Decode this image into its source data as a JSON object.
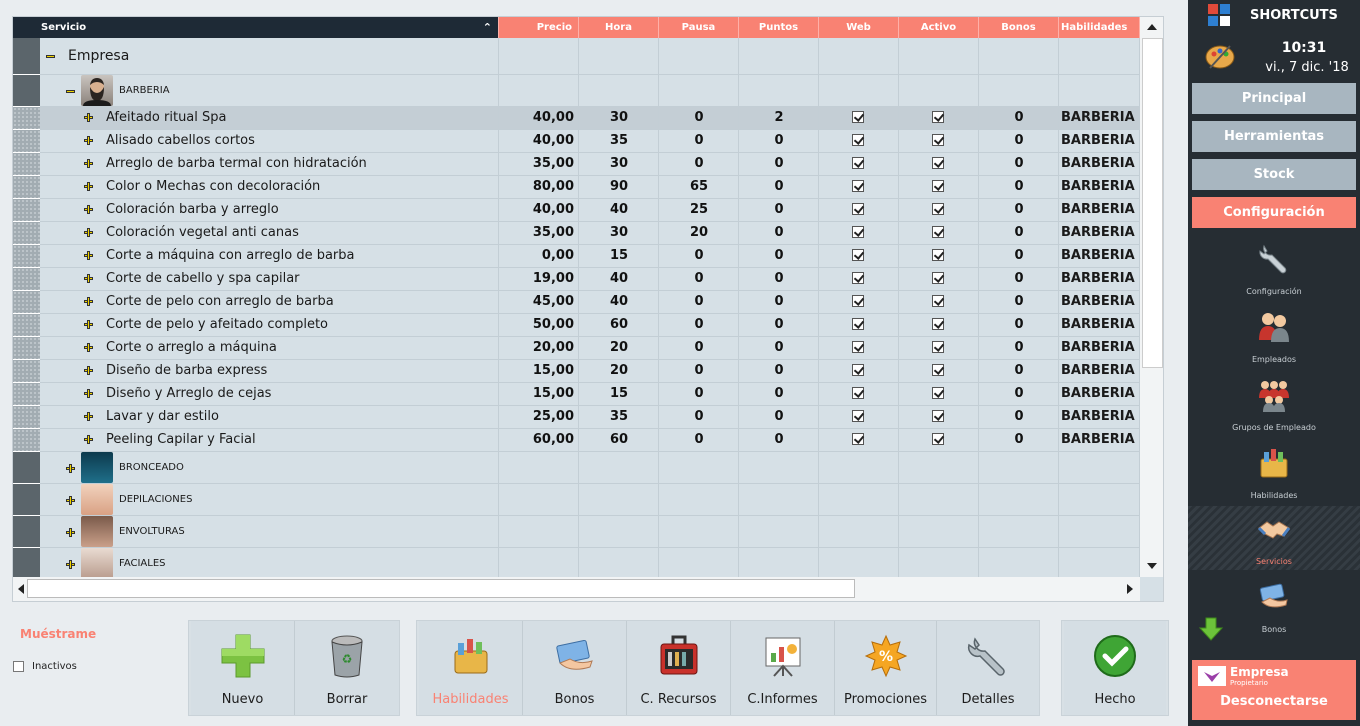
{
  "grid": {
    "columns": [
      "Servicio",
      "Precio",
      "Hora",
      "Pausa",
      "Puntos",
      "Web",
      "Activo",
      "Bonos",
      "Habilidades"
    ],
    "root_label": "Empresa",
    "group_expanded": "BARBERIA",
    "rows": [
      {
        "name": "Afeitado ritual Spa",
        "precio": "40,00",
        "hora": "30",
        "pausa": "0",
        "puntos": "2",
        "web": true,
        "activo": true,
        "bonos": "0",
        "hab": "BARBERIA"
      },
      {
        "name": "Alisado cabellos cortos",
        "precio": "40,00",
        "hora": "35",
        "pausa": "0",
        "puntos": "0",
        "web": true,
        "activo": true,
        "bonos": "0",
        "hab": "BARBERIA"
      },
      {
        "name": "Arreglo de barba termal con hidratación",
        "precio": "35,00",
        "hora": "30",
        "pausa": "0",
        "puntos": "0",
        "web": true,
        "activo": true,
        "bonos": "0",
        "hab": "BARBERIA"
      },
      {
        "name": "Color o Mechas con decoloración",
        "precio": "80,00",
        "hora": "90",
        "pausa": "65",
        "puntos": "0",
        "web": true,
        "activo": true,
        "bonos": "0",
        "hab": "BARBERIA"
      },
      {
        "name": "Coloración barba y arreglo",
        "precio": "40,00",
        "hora": "40",
        "pausa": "25",
        "puntos": "0",
        "web": true,
        "activo": true,
        "bonos": "0",
        "hab": "BARBERIA"
      },
      {
        "name": "Coloración vegetal anti canas",
        "precio": "35,00",
        "hora": "30",
        "pausa": "20",
        "puntos": "0",
        "web": true,
        "activo": true,
        "bonos": "0",
        "hab": "BARBERIA"
      },
      {
        "name": "Corte a máquina con arreglo de barba",
        "precio": "0,00",
        "hora": "15",
        "pausa": "0",
        "puntos": "0",
        "web": true,
        "activo": true,
        "bonos": "0",
        "hab": "BARBERIA"
      },
      {
        "name": "Corte de cabello y spa capilar",
        "precio": "19,00",
        "hora": "40",
        "pausa": "0",
        "puntos": "0",
        "web": true,
        "activo": true,
        "bonos": "0",
        "hab": "BARBERIA"
      },
      {
        "name": "Corte de pelo con arreglo de barba",
        "precio": "45,00",
        "hora": "40",
        "pausa": "0",
        "puntos": "0",
        "web": true,
        "activo": true,
        "bonos": "0",
        "hab": "BARBERIA"
      },
      {
        "name": "Corte de pelo y afeitado completo",
        "precio": "50,00",
        "hora": "60",
        "pausa": "0",
        "puntos": "0",
        "web": true,
        "activo": true,
        "bonos": "0",
        "hab": "BARBERIA"
      },
      {
        "name": "Corte o arreglo a máquina",
        "precio": "20,00",
        "hora": "20",
        "pausa": "0",
        "puntos": "0",
        "web": true,
        "activo": true,
        "bonos": "0",
        "hab": "BARBERIA"
      },
      {
        "name": "Diseño de barba express",
        "precio": "15,00",
        "hora": "20",
        "pausa": "0",
        "puntos": "0",
        "web": true,
        "activo": true,
        "bonos": "0",
        "hab": "BARBERIA"
      },
      {
        "name": "Diseño y Arreglo de cejas",
        "precio": "15,00",
        "hora": "15",
        "pausa": "0",
        "puntos": "0",
        "web": true,
        "activo": true,
        "bonos": "0",
        "hab": "BARBERIA"
      },
      {
        "name": "Lavar y dar estilo",
        "precio": "25,00",
        "hora": "35",
        "pausa": "0",
        "puntos": "0",
        "web": true,
        "activo": true,
        "bonos": "0",
        "hab": "BARBERIA"
      },
      {
        "name": "Peeling Capilar y Facial",
        "precio": "60,00",
        "hora": "60",
        "pausa": "0",
        "puntos": "0",
        "web": true,
        "activo": true,
        "bonos": "0",
        "hab": "BARBERIA"
      }
    ],
    "collapsed_groups": [
      "BRONCEADO",
      "DEPILACIONES",
      "ENVOLTURAS",
      "FACIALES"
    ]
  },
  "filter": {
    "title": "Muéstrame",
    "inactive_label": "Inactivos"
  },
  "buttons": {
    "nuevo": "Nuevo",
    "borrar": "Borrar",
    "habilidades": "Habilidades",
    "bonos": "Bonos",
    "recursos": "C. Recursos",
    "informes": "C.Informes",
    "promociones": "Promociones",
    "detalles": "Detalles",
    "hecho": "Hecho"
  },
  "sidebar": {
    "title": "SHORTCUTS",
    "time": "10:31",
    "date": "vi., 7 dic. '18",
    "nav": [
      "Principal",
      "Herramientas",
      "Stock",
      "Configuración"
    ],
    "items": [
      "Configuración",
      "Empleados",
      "Grupos de Empleado",
      "Habilidades",
      "Servicios",
      "Bonos"
    ],
    "company": "Empresa",
    "role": "Propietario",
    "logout": "Desconectarse"
  },
  "colors": {
    "accent": "#f98273",
    "header_dark": "#1e2a36",
    "sidebar": "#262d33",
    "nav": "#a8b6c0"
  }
}
